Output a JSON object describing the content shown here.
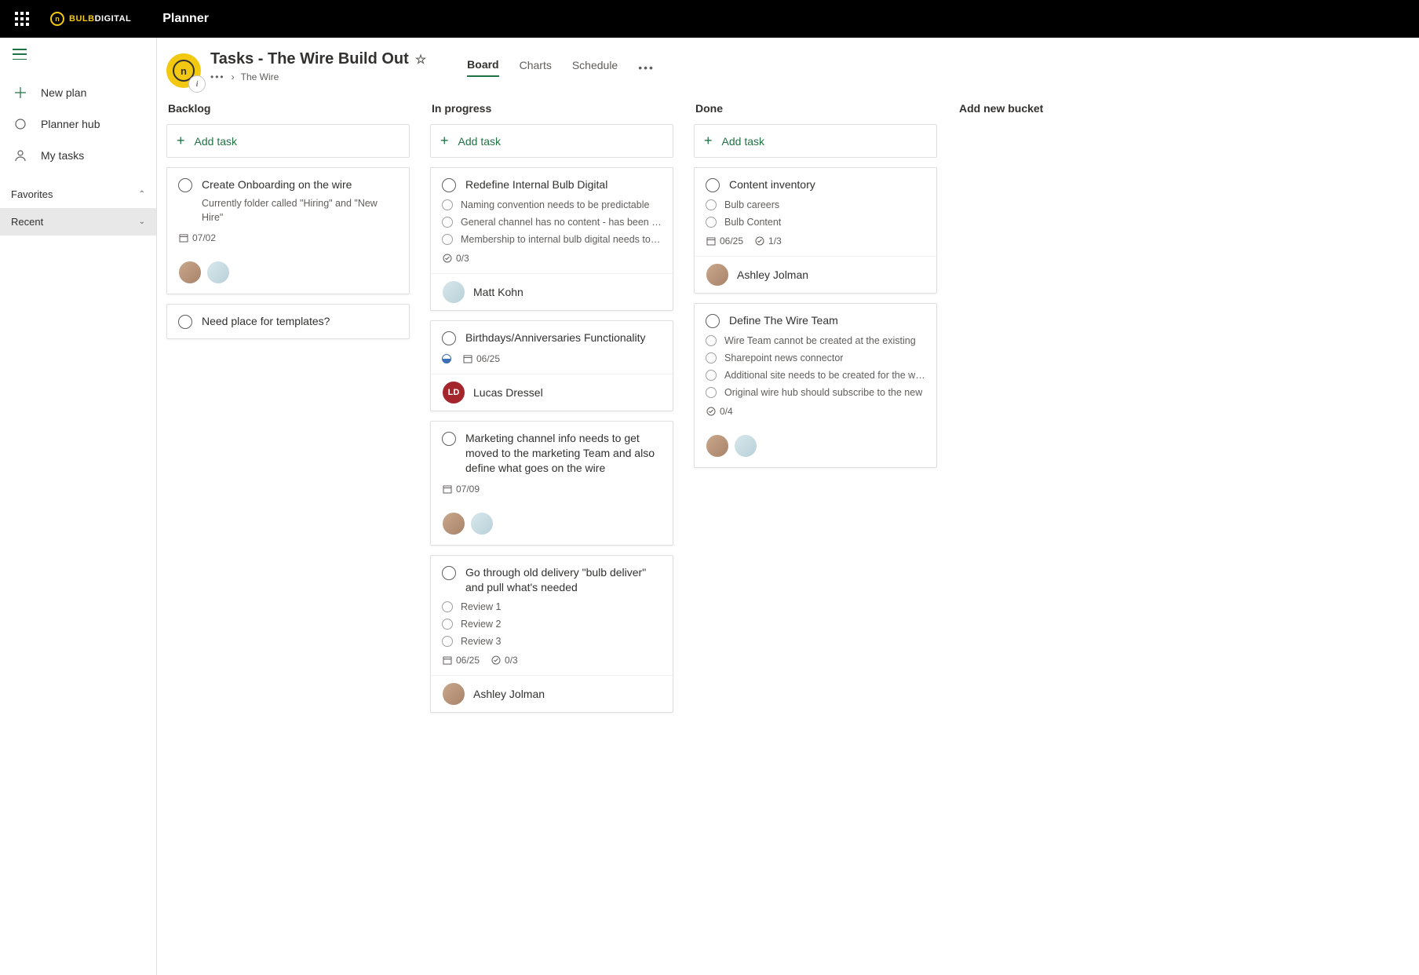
{
  "brand": {
    "bold": "BULB",
    "rest": "DIGITAL"
  },
  "app_name": "Planner",
  "sidebar": {
    "new_plan": "New plan",
    "hub": "Planner hub",
    "my_tasks": "My tasks",
    "favorites": "Favorites",
    "recent": "Recent"
  },
  "header": {
    "title": "Tasks - The Wire Build Out",
    "breadcrumb_parent": "The Wire"
  },
  "tabs": [
    "Board",
    "Charts",
    "Schedule"
  ],
  "add_task_label": "Add task",
  "add_bucket_label": "Add new bucket",
  "buckets": [
    {
      "name": "Backlog",
      "cards": [
        {
          "title": "Create Onboarding on the wire",
          "desc": "Currently folder called \"Hiring\" and \"New Hire\"",
          "date": "07/02",
          "avatars": [
            "f1",
            "f2"
          ]
        },
        {
          "title": "Need place for templates?"
        }
      ]
    },
    {
      "name": "In progress",
      "cards": [
        {
          "title": "Redefine Internal Bulb Digital",
          "checklist": [
            "Naming convention needs to be predictable",
            "General channel has no content - has been cleaned",
            "Membership to internal bulb digital needs to be reviewed"
          ],
          "progress": "0/3",
          "assignee": {
            "name": "Matt Kohn",
            "avatar": "f2"
          }
        },
        {
          "title": "Birthdays/Anniversaries Functionality",
          "half": true,
          "date": "06/25",
          "assignee": {
            "name": "Lucas Dressel",
            "avatar": "ld",
            "initials": "LD"
          }
        },
        {
          "title": "Marketing channel info needs to get moved to the marketing Team and also define what goes on the wire",
          "date": "07/09",
          "avatars": [
            "f1",
            "f2"
          ]
        },
        {
          "title": "Go through old delivery \"bulb deliver\" and pull what's needed",
          "checklist": [
            "Review 1",
            "Review 2",
            "Review 3"
          ],
          "date": "06/25",
          "progress": "0/3",
          "assignee": {
            "name": "Ashley Jolman",
            "avatar": "f1"
          }
        }
      ]
    },
    {
      "name": "Done",
      "cards": [
        {
          "title": "Content inventory",
          "checklist": [
            "Bulb careers",
            "Bulb Content"
          ],
          "date": "06/25",
          "progress": "1/3",
          "assignee": {
            "name": "Ashley Jolman",
            "avatar": "f1"
          }
        },
        {
          "title": "Define The Wire Team",
          "checklist": [
            "Wire Team cannot be created at the existing",
            "Sharepoint news connector",
            "Additional site needs to be created for the wire",
            "Original wire hub should subscribe to the new"
          ],
          "progress": "0/4",
          "avatars": [
            "f1",
            "f2"
          ]
        }
      ]
    }
  ]
}
